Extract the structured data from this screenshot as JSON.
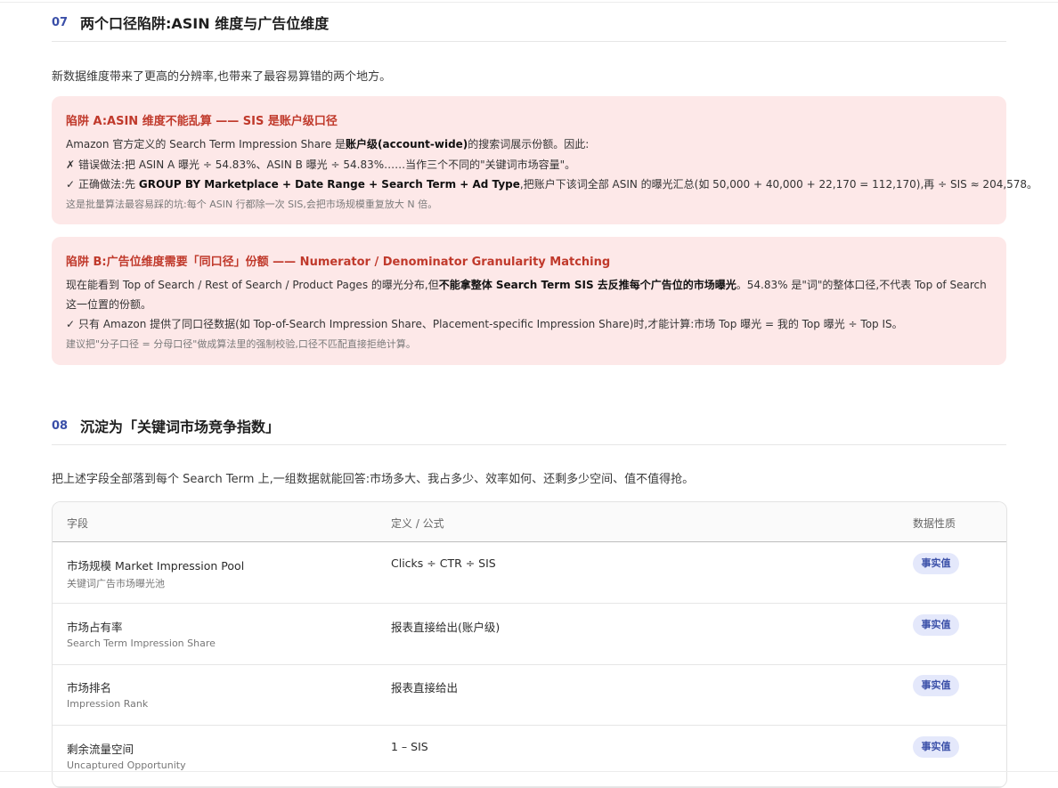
{
  "section07": {
    "num": "07",
    "title": "两个口径陷阱:ASIN 维度与广告位维度",
    "intro": "新数据维度带来了更高的分辨率,也带来了最容易算错的两个地方。"
  },
  "pitfallA": {
    "title": "陷阱 A:ASIN 维度不能乱算 —— SIS 是账户级口径",
    "line1_pre": "Amazon 官方定义的 Search Term Impression Share 是",
    "line1_bold": "账户级(account-wide)",
    "line1_post": "的搜索词展示份额。因此:",
    "wrong_mark": "✗",
    "wrong_text": "错误做法:把 ASIN A 曝光 ÷ 54.83%、ASIN B 曝光 ÷ 54.83%……当作三个不同的\"关键词市场容量\"。",
    "right_mark": "✓",
    "right_pre": "正确做法:先 ",
    "right_bold": "GROUP BY Marketplace + Date Range + Search Term + Ad Type",
    "right_post": ",把账户下该词全部 ASIN 的曝光汇总(如 50,000 + 40,000 + 22,170 = 112,170),再 ÷ SIS ≈ 204,578。",
    "note": "这是批量算法最容易踩的坑:每个 ASIN 行都除一次 SIS,会把市场规模重复放大 N 倍。"
  },
  "pitfallB": {
    "title": "陷阱 B:广告位维度需要「同口径」份额 —— Numerator / Denominator Granularity Matching",
    "line1_pre": "现在能看到 Top of Search / Rest of Search / Product Pages 的曝光分布,但",
    "line1_bold": "不能拿整体 Search Term SIS 去反推每个广告位的市场曝光",
    "line1_post": "。54.83% 是\"词\"的整体口径,不代表 Top of Search",
    "line2": "这一位置的份额。",
    "right_mark": "✓",
    "right_text": "只有 Amazon 提供了同口径数据(如 Top-of-Search Impression Share、Placement-specific Impression Share)时,才能计算:市场 Top 曝光 = 我的 Top 曝光 ÷ Top IS。",
    "note": "建议把\"分子口径 = 分母口径\"做成算法里的强制校验,口径不匹配直接拒绝计算。"
  },
  "section08": {
    "num": "08",
    "title": "沉淀为「关键词市场竞争指数」",
    "intro": "把上述字段全部落到每个 Search Term 上,一组数据就能回答:市场多大、我占多少、效率如何、还剩多少空间、值不值得抢。"
  },
  "table": {
    "headers": [
      "字段",
      "定义 / 公式",
      "数据性质"
    ],
    "rows": [
      {
        "name": "市场规模 Market Impression Pool",
        "sub": "关键词广告市场曝光池",
        "def": "Clicks ÷ CTR ÷ SIS",
        "badge": "事实值"
      },
      {
        "name": "市场占有率",
        "sub": "Search Term Impression Share",
        "def": "报表直接给出(账户级)",
        "badge": "事实值"
      },
      {
        "name": "市场排名",
        "sub": "Impression Rank",
        "def": "报表直接给出",
        "badge": "事实值"
      },
      {
        "name": "剩余流量空间",
        "sub": "Uncaptured Opportunity",
        "def": "1 – SIS",
        "badge": "事实值"
      }
    ]
  },
  "colors": {
    "accent": "#3a4fa8",
    "danger": "#c0392b",
    "card_bg": "#fde8e8",
    "badge_bg": "#e4e8fb"
  }
}
